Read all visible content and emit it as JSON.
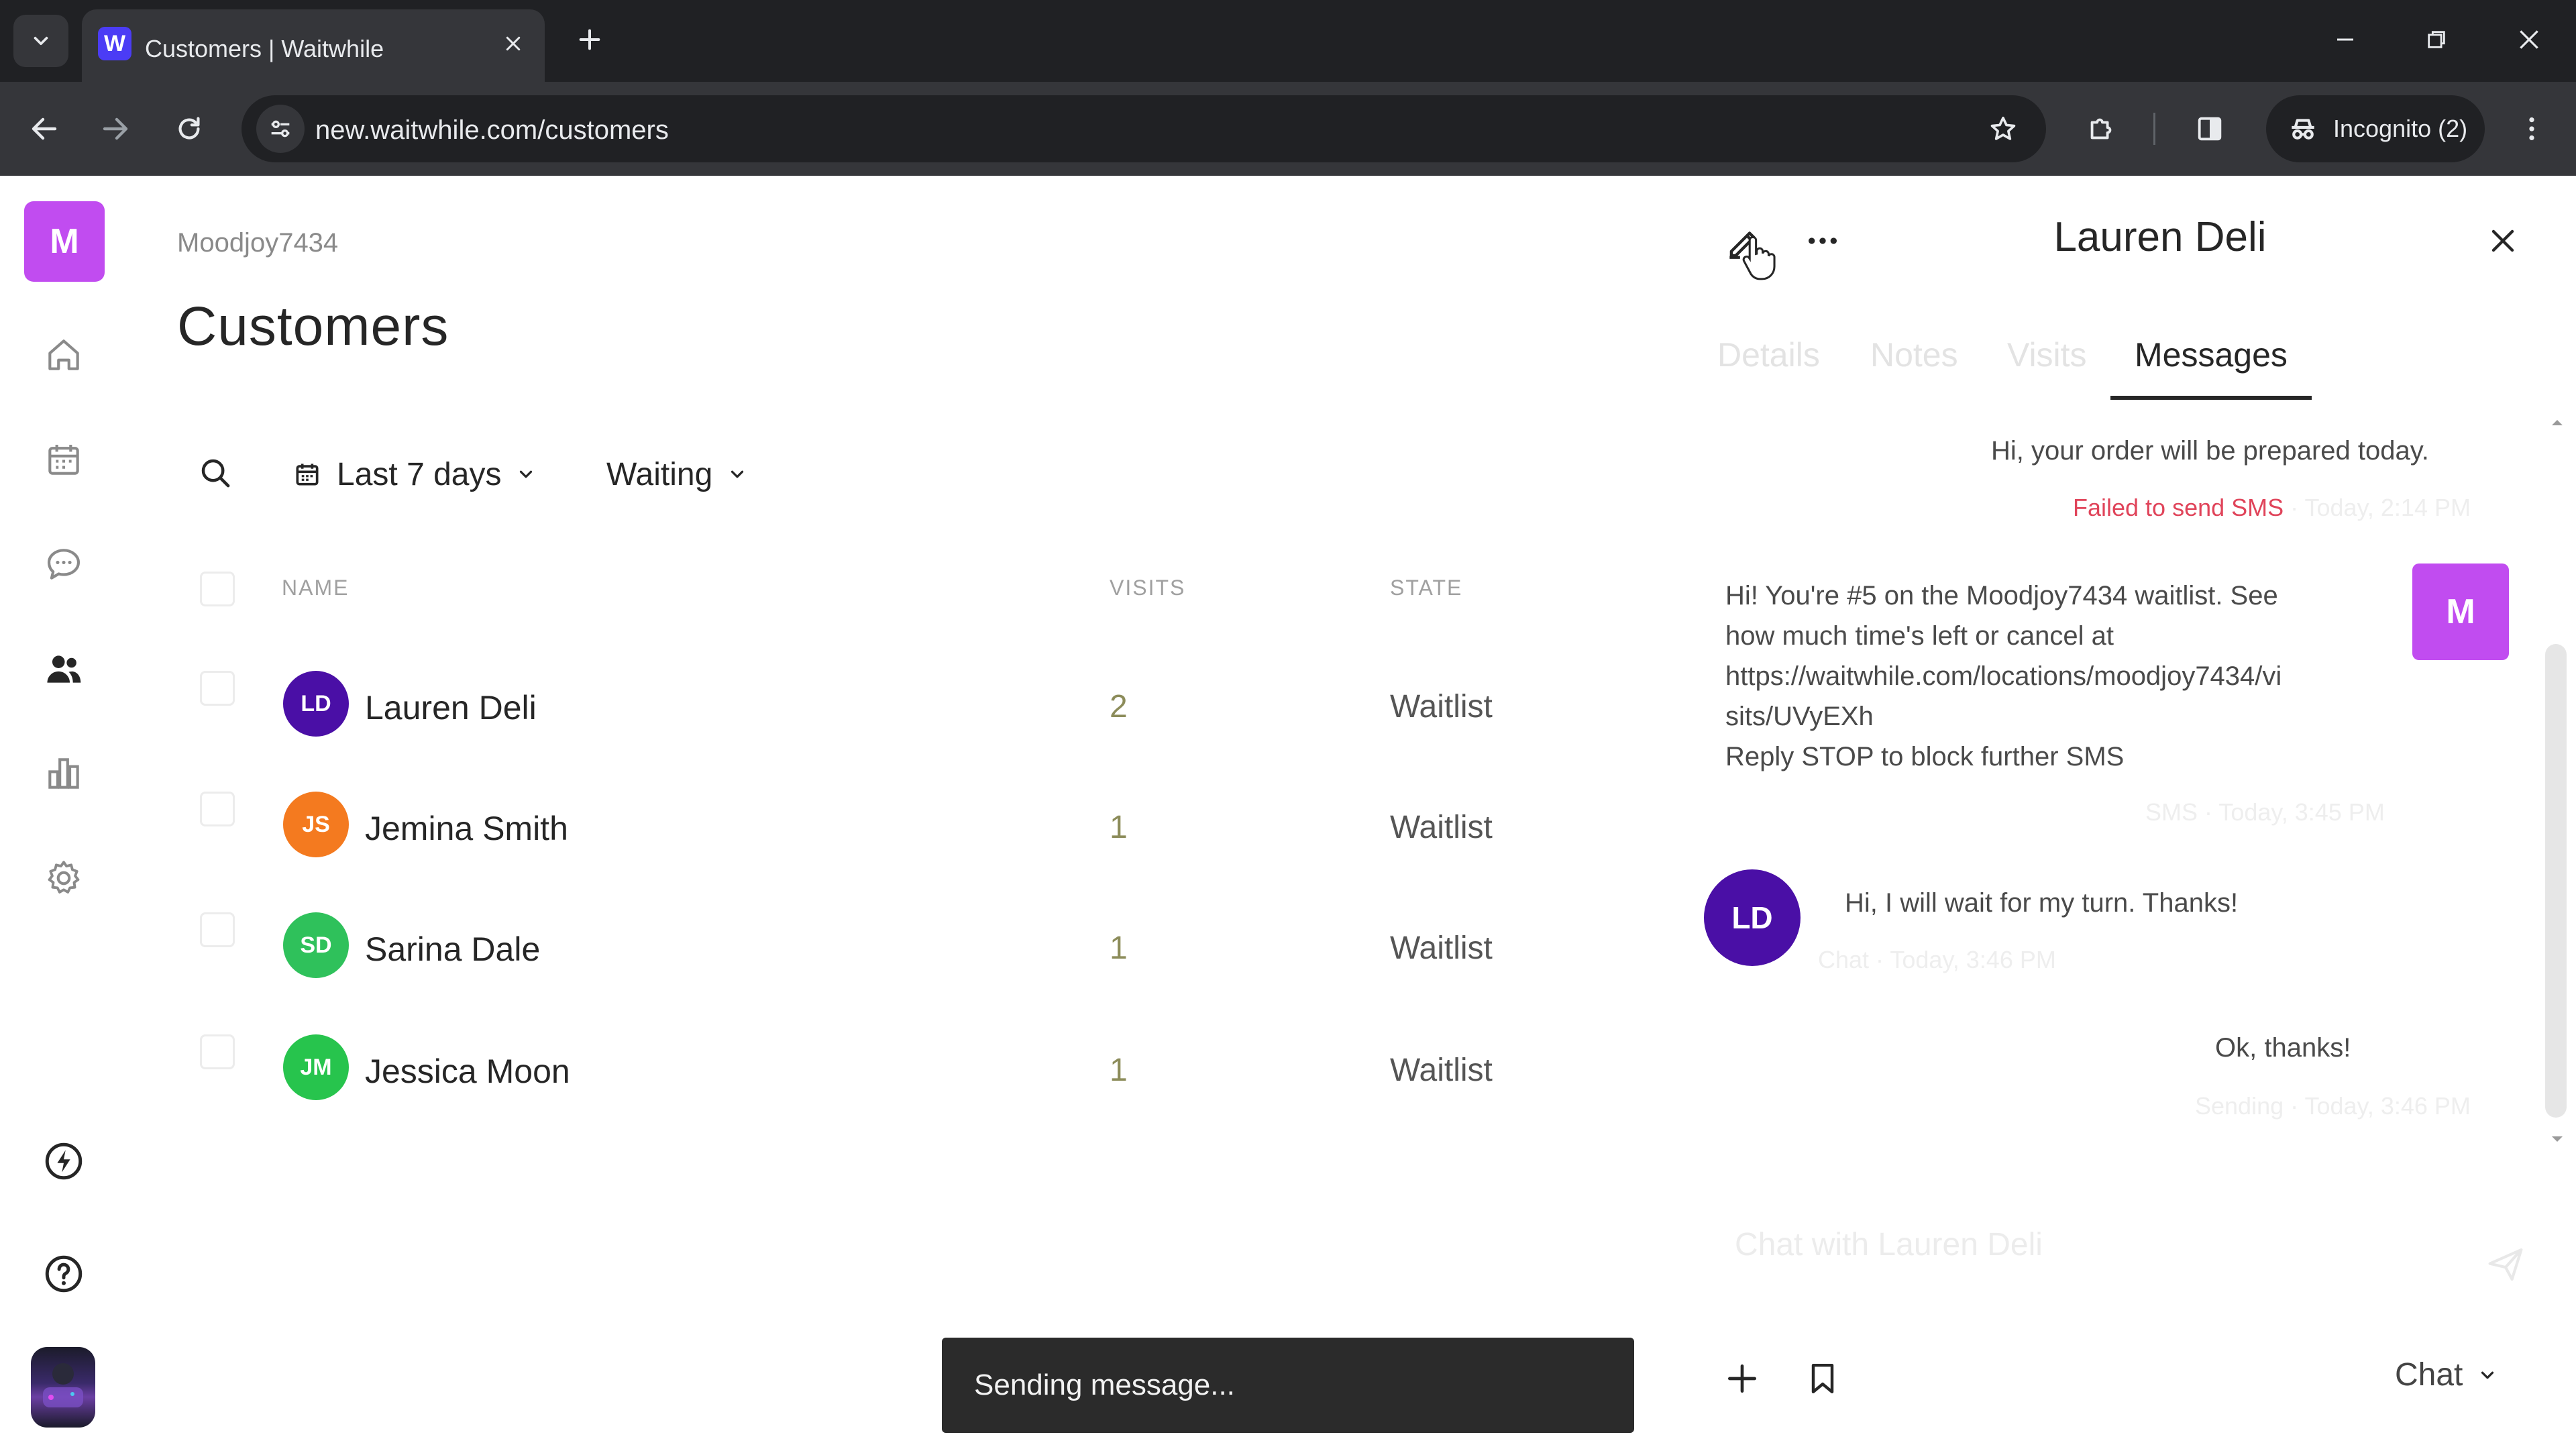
{
  "browser": {
    "tab_title": "Customers | Waitwhile",
    "favicon_letter": "W",
    "url": "new.waitwhile.com/customers",
    "incognito_label": "Incognito (2)"
  },
  "sidebar": {
    "brand_letter": "M",
    "items": [
      {
        "name": "home",
        "icon": "home-icon"
      },
      {
        "name": "calendar",
        "icon": "calendar-icon"
      },
      {
        "name": "messages",
        "icon": "chat-bubble-icon"
      },
      {
        "name": "customers",
        "icon": "people-icon",
        "active": true
      },
      {
        "name": "analytics",
        "icon": "bar-chart-icon"
      },
      {
        "name": "settings",
        "icon": "gear-icon"
      },
      {
        "name": "automation",
        "icon": "lightning-icon"
      },
      {
        "name": "help",
        "icon": "help-icon"
      }
    ]
  },
  "main": {
    "org_name": "Moodjoy7434",
    "title": "Customers",
    "filters": {
      "date": "Last 7 days",
      "state": "Waiting"
    },
    "columns": {
      "name": "NAME",
      "visits": "VISITS",
      "state": "STATE"
    },
    "rows": [
      {
        "initials": "LD",
        "name": "Lauren Deli",
        "visits": "2",
        "state": "Waitlist",
        "color": "#4a0fa6"
      },
      {
        "initials": "JS",
        "name": "Jemina Smith",
        "visits": "1",
        "state": "Waitlist",
        "color": "#f47a1f"
      },
      {
        "initials": "SD",
        "name": "Sarina Dale",
        "visits": "1",
        "state": "Waitlist",
        "color": "#2fc15b"
      },
      {
        "initials": "JM",
        "name": "Jessica Moon",
        "visits": "1",
        "state": "Waitlist",
        "color": "#27c44d"
      }
    ]
  },
  "toast": {
    "text": "Sending message..."
  },
  "panel": {
    "title": "Lauren Deli",
    "tabs": {
      "details": "Details",
      "notes": "Notes",
      "visits": "Visits",
      "messages": "Messages"
    },
    "messages": [
      {
        "text": "Hi, your order will be prepared today.",
        "meta_status": "Failed to send SMS",
        "meta_time": " · Today, 2:14 PM"
      },
      {
        "lines": [
          "Hi! You're #5 on the Moodjoy7434 waitlist. See",
          "how much time's left or cancel at",
          "https://waitwhile.com/locations/moodjoy7434/vi",
          "sits/UVyEXh",
          "Reply STOP to block further SMS"
        ],
        "meta": "SMS · Today, 3:45 PM",
        "avatar": "M"
      },
      {
        "text": "Hi, I will wait for my turn. Thanks!",
        "meta": "Chat · Today, 3:46 PM",
        "avatar": "LD"
      },
      {
        "text": "Ok, thanks!",
        "meta": "Sending · Today, 3:46 PM"
      }
    ],
    "chat_placeholder": "Chat with Lauren Deli",
    "channel": "Chat"
  },
  "colors": {
    "brand": "#c14cf0",
    "failed": "#e0445a"
  }
}
